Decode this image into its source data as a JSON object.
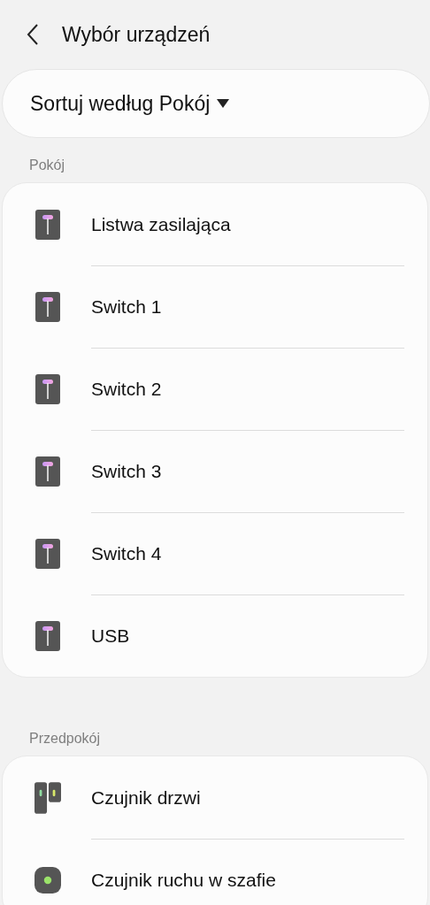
{
  "header": {
    "title": "Wybór urządzeń"
  },
  "sort": {
    "label": "Sortuj według Pokój"
  },
  "groups": [
    {
      "title": "Pokój",
      "devices": [
        {
          "name": "Listwa zasilająca",
          "kind": "plug"
        },
        {
          "name": "Switch 1",
          "kind": "plug"
        },
        {
          "name": "Switch 2",
          "kind": "plug"
        },
        {
          "name": "Switch 3",
          "kind": "plug"
        },
        {
          "name": "Switch 4",
          "kind": "plug"
        },
        {
          "name": "USB",
          "kind": "plug"
        }
      ]
    },
    {
      "title": "Przedpokój",
      "devices": [
        {
          "name": "Czujnik drzwi",
          "kind": "door"
        },
        {
          "name": "Czujnik ruchu w szafie",
          "kind": "motion"
        }
      ]
    }
  ]
}
